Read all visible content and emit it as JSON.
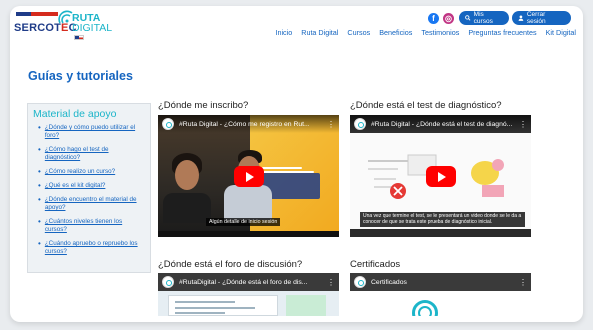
{
  "brand": {
    "sercotec_prefix": "SERCOT",
    "sercotec_e": "E",
    "sercotec_suffix": "C",
    "ruta": "RUTA",
    "digital": "DIGITAL"
  },
  "header": {
    "mis_cursos": "Mis cursos",
    "cerrar_sesion": "Cerrar sesión",
    "facebook_icon": "f",
    "instagram_icon": "◎",
    "nav": [
      "Inicio",
      "Ruta Digital",
      "Cursos",
      "Beneficios",
      "Testimonios",
      "Preguntas frecuentes",
      "Kit Digital"
    ]
  },
  "page_title": "Guías y tutoriales",
  "sidebar": {
    "title": "Material de apoyo",
    "links": [
      [
        "¿Dónde y cómo puedo utilizar el",
        "foro?"
      ],
      [
        "¿Cómo hago el test de",
        "diagnóstico?"
      ],
      [
        "¿Cómo realizo un curso?"
      ],
      [
        "¿Qué es el kit digital?"
      ],
      [
        "¿Dónde encuentro el material de",
        "apoyo?"
      ],
      [
        "¿Cuántos niveles tienen los",
        "cursos?"
      ],
      [
        "¿Cuándo apruebo o repruebo los",
        "cursos?"
      ]
    ]
  },
  "videos": [
    {
      "section": "¿Dónde me inscribo?",
      "title": "#Ruta Digital - ¿Cómo me registro en Rut...",
      "caption": "Algún detalle de inicio sesión"
    },
    {
      "section": "¿Dónde está el test de diagnóstico?",
      "title": "#Ruta Digital - ¿Dónde está el test de diagnó...",
      "caption": "Una vez que termine el test, se le presentará un video donde se le da a conocer de que se trata este prueba de diagnóstico inicial."
    },
    {
      "section": "¿Dónde está el foro de discusión?",
      "title": "#RutaDigital - ¿Dónde está el foro de dis..."
    },
    {
      "section": "Certificados",
      "title": "Certificados"
    }
  ],
  "colors": {
    "primary": "#1565c0",
    "accent": "#1cb5c9",
    "youtube": "#ff0000"
  }
}
